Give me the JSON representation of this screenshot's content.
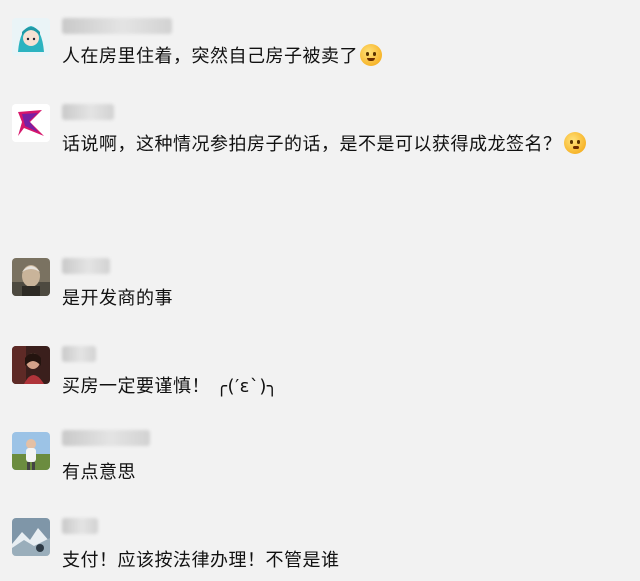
{
  "comments": [
    {
      "text": "人在房里住着，突然自己房子被卖了",
      "emoji": "grinning-face-emoji"
    },
    {
      "text": "话说啊，这种情况参拍房子的话，是不是可以获得成龙签名？",
      "emoji": "thinking-face-emoji"
    },
    {
      "text": "是开发商的事"
    },
    {
      "text": "买房一定要谨慎！ ╭(′ε`)╮"
    },
    {
      "text": "有点意思"
    },
    {
      "text": "支付！应该按法律办理！不管是谁"
    }
  ],
  "colors": {
    "background": "#f2f2f2",
    "text": "#111111"
  }
}
